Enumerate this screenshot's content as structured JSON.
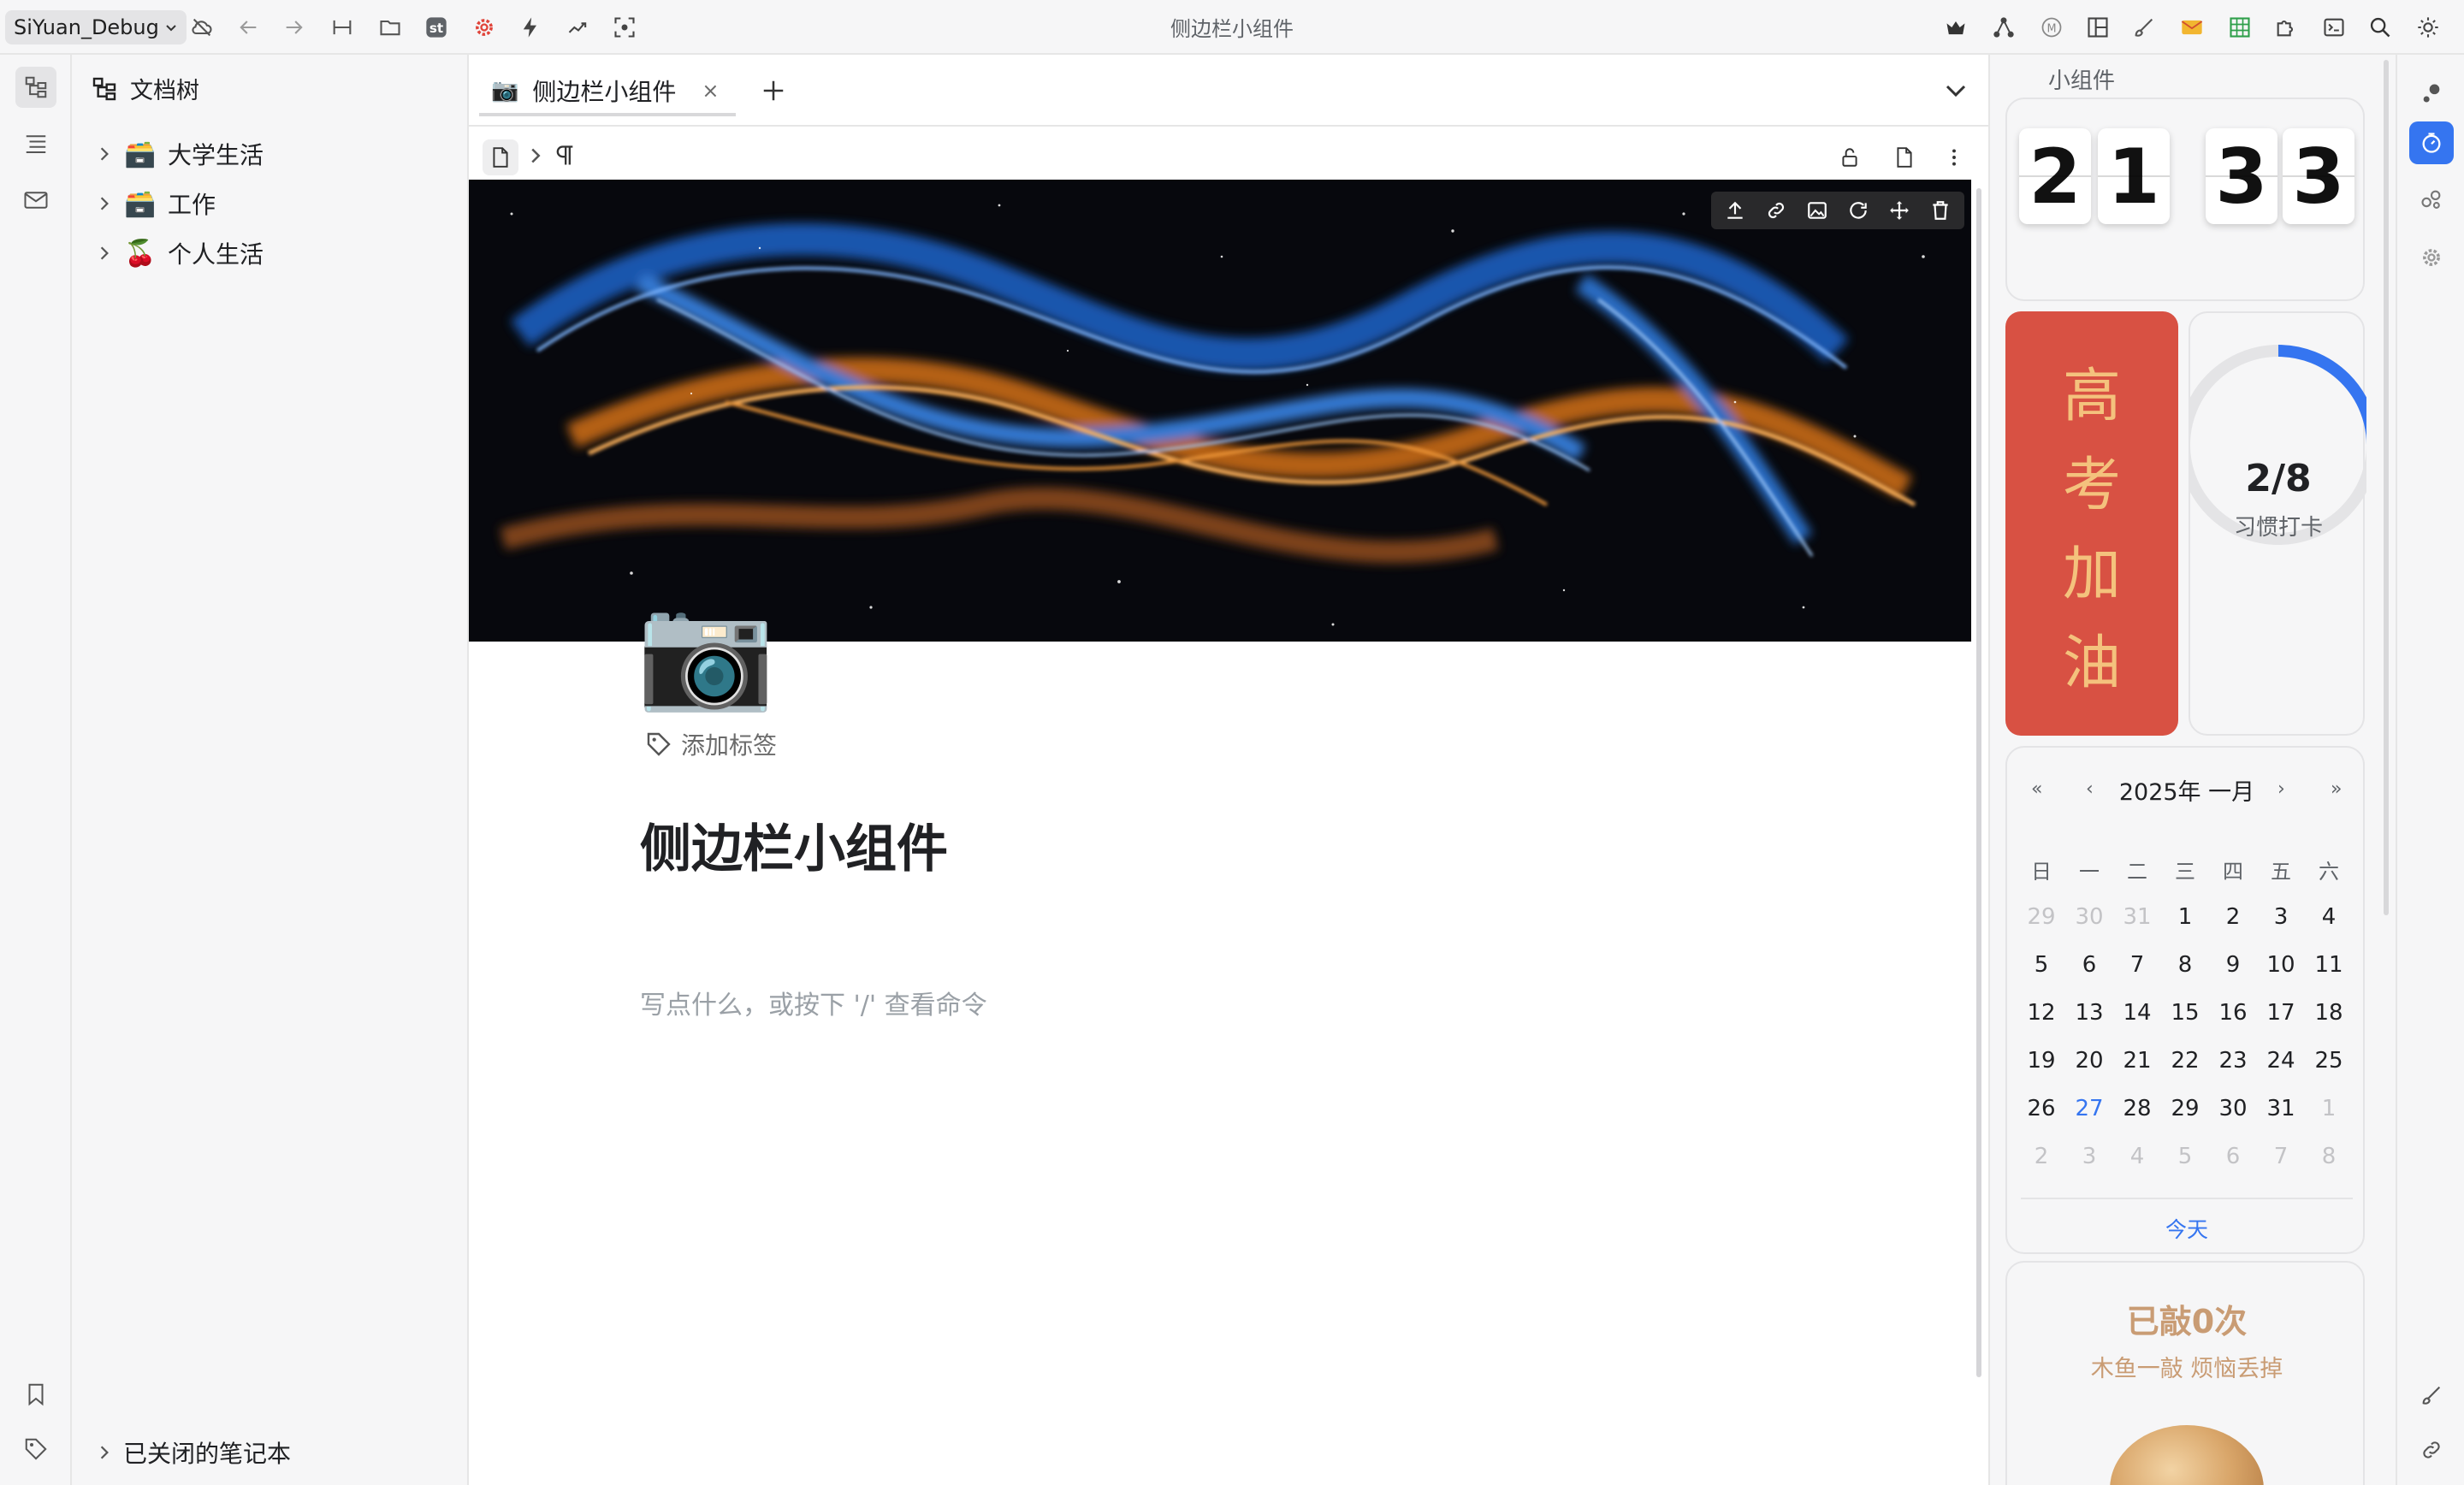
{
  "toolbar": {
    "workspace": "SiYuan_Debug",
    "window_title": "侧边栏小组件",
    "left_icons": [
      "cloud-sync-icon",
      "back-icon",
      "forward-icon",
      "split-icon",
      "folder-icon",
      "st-plugin-icon",
      "settings-plugin-icon",
      "lightning-icon",
      "trend-icon",
      "focus-icon"
    ],
    "right_icons": [
      "crown-icon",
      "graph-icon",
      "m-icon",
      "layout-icon",
      "brush-icon",
      "envelope-icon",
      "grid-icon",
      "puzzle-icon",
      "terminal-icon",
      "search-icon",
      "theme-icon"
    ]
  },
  "filetree": {
    "title": "文档树",
    "notebooks": [
      {
        "emoji": "🗃️",
        "label": "大学生活"
      },
      {
        "emoji": "🗃️",
        "label": "工作"
      },
      {
        "emoji": "🍒",
        "label": "个人生活"
      }
    ],
    "closed_label": "已关闭的笔记本"
  },
  "editor": {
    "tab": {
      "emoji": "📷",
      "label": "侧边栏小组件",
      "close": "×"
    },
    "doc_icon": "📷",
    "add_tag": "添加标签",
    "title": "侧边栏小组件",
    "placeholder": "写点什么，或按下 '/' 查看命令"
  },
  "widgets": {
    "title": "小组件",
    "flip_clock": [
      "2",
      "1",
      "3",
      "3"
    ],
    "motivation": [
      "高",
      "考",
      "加",
      "油"
    ],
    "habit": {
      "count": "2/8",
      "label": "习惯打卡",
      "progress": 0.25,
      "color": "#3575f0"
    },
    "calendar": {
      "header": "2025年 一月",
      "nav": {
        "prev_year": "«",
        "prev_month": "‹",
        "next_month": "›",
        "next_year": "»"
      },
      "weekdays": [
        "日",
        "一",
        "二",
        "三",
        "四",
        "五",
        "六"
      ],
      "weeks": [
        [
          {
            "d": "29",
            "m": true
          },
          {
            "d": "30",
            "m": true
          },
          {
            "d": "31",
            "m": true
          },
          {
            "d": "1"
          },
          {
            "d": "2"
          },
          {
            "d": "3"
          },
          {
            "d": "4"
          }
        ],
        [
          {
            "d": "5"
          },
          {
            "d": "6"
          },
          {
            "d": "7"
          },
          {
            "d": "8"
          },
          {
            "d": "9"
          },
          {
            "d": "10"
          },
          {
            "d": "11"
          }
        ],
        [
          {
            "d": "12"
          },
          {
            "d": "13"
          },
          {
            "d": "14"
          },
          {
            "d": "15"
          },
          {
            "d": "16"
          },
          {
            "d": "17"
          },
          {
            "d": "18"
          }
        ],
        [
          {
            "d": "19"
          },
          {
            "d": "20"
          },
          {
            "d": "21"
          },
          {
            "d": "22"
          },
          {
            "d": "23"
          },
          {
            "d": "24"
          },
          {
            "d": "25"
          }
        ],
        [
          {
            "d": "26"
          },
          {
            "d": "27",
            "t": true
          },
          {
            "d": "28"
          },
          {
            "d": "29"
          },
          {
            "d": "30"
          },
          {
            "d": "31"
          },
          {
            "d": "1",
            "m": true
          }
        ],
        [
          {
            "d": "2",
            "m": true
          },
          {
            "d": "3",
            "m": true
          },
          {
            "d": "4",
            "m": true
          },
          {
            "d": "5",
            "m": true
          },
          {
            "d": "6",
            "m": true
          },
          {
            "d": "7",
            "m": true
          },
          {
            "d": "8",
            "m": true
          }
        ]
      ],
      "today_button": "今天"
    },
    "muyu": {
      "count": "已敲0次",
      "subtitle": "木鱼一敲 烦恼丢掉"
    }
  },
  "colors": {
    "accent": "#3575f0",
    "gaokao_bg": "#d85143",
    "gaokao_text": "#f4c27d",
    "muyu_text": "#c99c74"
  }
}
